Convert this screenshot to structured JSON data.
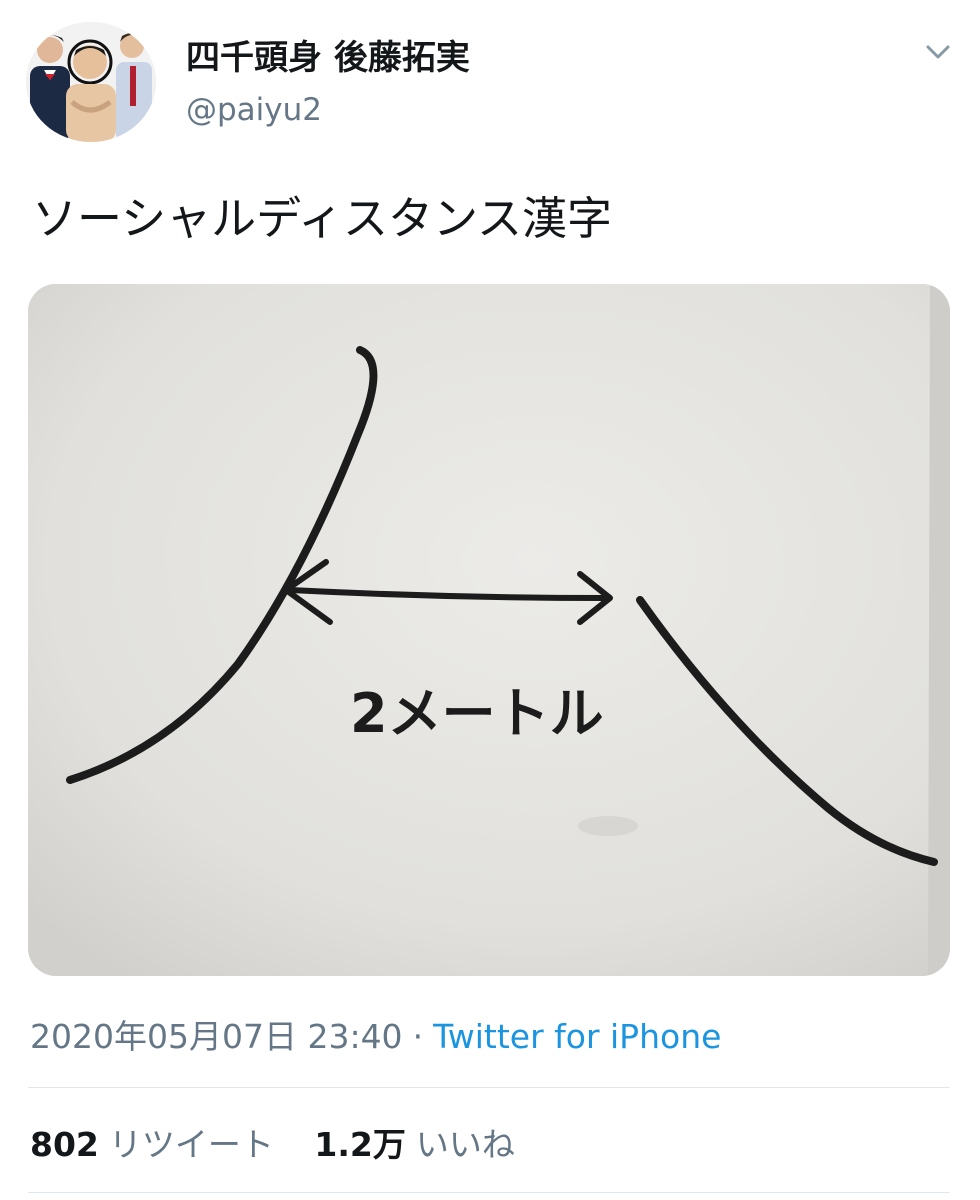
{
  "user": {
    "display_name": "四千頭身 後藤拓実",
    "handle": "@paiyu2",
    "avatar_icon": "avatar-photo-icon"
  },
  "header": {
    "menu_icon": "chevron-down-icon"
  },
  "tweet": {
    "text": "ソーシャルディスタンス漢字",
    "media": {
      "description_icon": "handwritten-drawing-image",
      "handwritten_label": "2メートル"
    }
  },
  "meta": {
    "timestamp": "2020年05月07日 23:40",
    "separator": "·",
    "source": "Twitter for iPhone"
  },
  "stats": {
    "retweets_count": "802",
    "retweets_label": "リツイート",
    "likes_count": "1.2万",
    "likes_label": "いいね"
  },
  "colors": {
    "text": "#14171a",
    "secondary": "#657786",
    "link": "#1b95e0",
    "divider": "#e1e8ed"
  }
}
